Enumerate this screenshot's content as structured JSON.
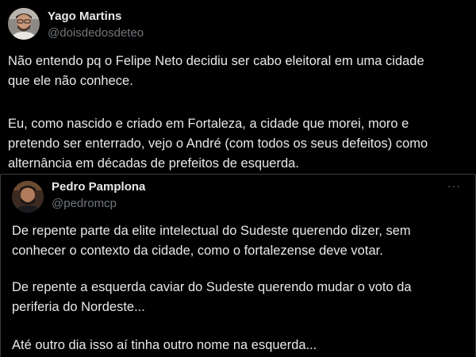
{
  "tweets": [
    {
      "author": {
        "name": "Yago Martins",
        "handle": "@doisdedosdeteo"
      },
      "lines": [
        "Não entendo pq o Felipe Neto decidiu ser cabo eleitoral em uma cidade",
        "que ele não conhece.",
        "Eu, como nascido e criado em Fortaleza, a cidade que morei, moro e",
        "pretendo ser enterrado, vejo o André (com todos os seus defeitos) como",
        "alternância em décadas de prefeitos de esquerda."
      ]
    },
    {
      "author": {
        "name": "Pedro Pamplona",
        "handle": "@pedromcp"
      },
      "more_label": "···",
      "lines": [
        "De repente parte da elite intelectual do Sudeste querendo dizer, sem",
        "conhecer o contexto da cidade, como o fortalezense deve votar.",
        "De repente a esquerda caviar do Sudeste querendo mudar o voto da",
        "periferia do Nordeste...",
        "Até outro dia isso aí tinha outro nome na esquerda..."
      ]
    }
  ],
  "icons": {
    "avatar_1": "avatar-photo",
    "avatar_2": "avatar-photo",
    "more": "more-options-icon"
  },
  "colors": {
    "background": "#000000",
    "text_primary": "#e7e9ea",
    "text_secondary": "#71767b",
    "divider": "#2f3336"
  }
}
